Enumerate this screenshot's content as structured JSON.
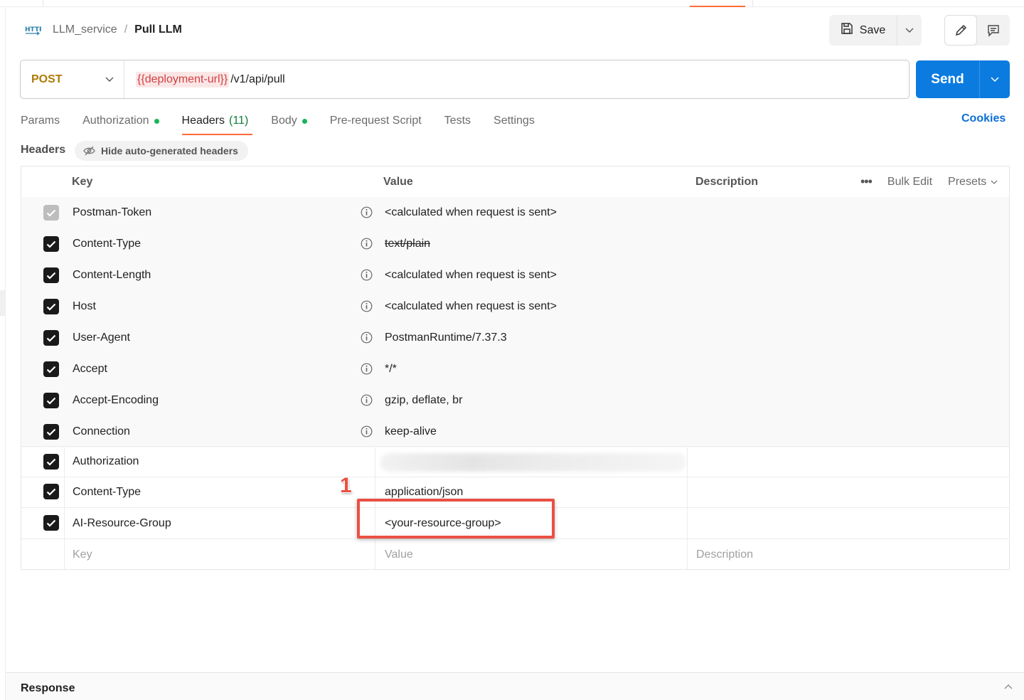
{
  "breadcrumb": {
    "icon": "http-icon",
    "parent": "LLM_service",
    "separator": "/",
    "current": "Pull LLM"
  },
  "toolbar": {
    "save_label": "Save"
  },
  "request": {
    "method": "POST",
    "url_variable": "{{deployment-url}}",
    "url_path": "/v1/api/pull",
    "send_label": "Send"
  },
  "tabs": [
    {
      "label": "Params"
    },
    {
      "label": "Authorization"
    },
    {
      "label": "Headers",
      "count": "(11)"
    },
    {
      "label": "Body"
    },
    {
      "label": "Pre-request Script"
    },
    {
      "label": "Tests"
    },
    {
      "label": "Settings"
    }
  ],
  "cookies_label": "Cookies",
  "headers_section": {
    "label": "Headers",
    "hide_auto_label": "Hide auto-generated headers"
  },
  "table": {
    "columns": {
      "key": "Key",
      "value": "Value",
      "description": "Description"
    },
    "tools": {
      "bulk_edit": "Bulk Edit",
      "presets": "Presets"
    },
    "rows": [
      {
        "key": "Postman-Token",
        "value": "<calculated when request is sent>"
      },
      {
        "key": "Content-Type",
        "value": "text/plain"
      },
      {
        "key": "Content-Length",
        "value": "<calculated when request is sent>"
      },
      {
        "key": "Host",
        "value": "<calculated when request is sent>"
      },
      {
        "key": "User-Agent",
        "value": "PostmanRuntime/7.37.3"
      },
      {
        "key": "Accept",
        "value": "*/*"
      },
      {
        "key": "Accept-Encoding",
        "value": "gzip, deflate, br"
      },
      {
        "key": "Connection",
        "value": "keep-alive"
      },
      {
        "key": "Authorization",
        "value": ""
      },
      {
        "key": "Content-Type",
        "value": "application/json"
      },
      {
        "key": "AI-Resource-Group",
        "value": "<your-resource-group>"
      }
    ],
    "new_row": {
      "key_placeholder": "Key",
      "value_placeholder": "Value",
      "description_placeholder": "Description"
    }
  },
  "annotation": {
    "number": "1"
  },
  "response": {
    "title": "Response"
  },
  "colors": {
    "accent": "#ff6c37",
    "send": "#0b7be0",
    "method": "#ad7a03",
    "variable": "#d23f3f",
    "annotation": "#ea5043",
    "status_dot": "#1bb35a"
  }
}
